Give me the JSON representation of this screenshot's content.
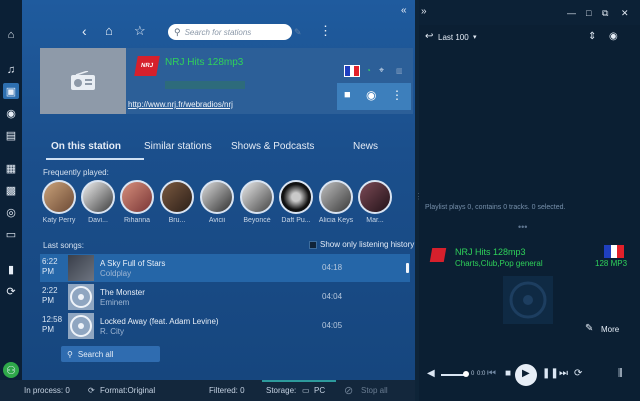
{
  "search": {
    "placeholder": "Search for stations"
  },
  "station": {
    "name": "NRJ Hits 128mp3",
    "url": "http://www.nrj.fr/webradios/nrj",
    "badge": "NRJ"
  },
  "tabs": [
    "On this station",
    "Similar stations",
    "Shows & Podcasts",
    "News"
  ],
  "frequently_played": {
    "label": "Frequently played:",
    "artists": [
      "Katy Perry",
      "Davi...",
      "Rihanna",
      "Bru...",
      "Avicii",
      "Beyoncé",
      "Daft Pu...",
      "Alicia Keys",
      "Mar..."
    ]
  },
  "last_songs": {
    "label": "Last songs:",
    "checkbox_label": "Show only listening history",
    "rows": [
      {
        "time": "6:22",
        "ampm": "PM",
        "title": "A Sky Full of Stars",
        "artist": "Coldplay",
        "duration": "04:18"
      },
      {
        "time": "2:22",
        "ampm": "PM",
        "title": "The Monster",
        "artist": "Eminem",
        "duration": "04:04"
      },
      {
        "time": "12:58",
        "ampm": "PM",
        "title": "Locked Away (feat. Adam Levine)",
        "artist": "R. City",
        "duration": "04:05"
      }
    ]
  },
  "search_all": "Search all",
  "status": {
    "in_process": "In process: 0",
    "format": "Format:Original",
    "filtered": "Filtered: 0",
    "storage_label": "Storage:",
    "storage_value": "PC",
    "stop_all": "Stop all"
  },
  "right": {
    "playlist_name": "Last 100",
    "playlist_info": "Playlist plays 0, contains 0 tracks. 0 selected.",
    "now_playing_name": "NRJ Hits 128mp3",
    "now_playing_genre": "Charts,Club,Pop general",
    "now_playing_quality": "128 MP3",
    "more_label": "More",
    "time_elapsed": "0",
    "time_total": "0:0"
  },
  "colors": {
    "accent": "#2d6fb0",
    "green_text": "#2fd25a",
    "rail": "#0b2036"
  }
}
